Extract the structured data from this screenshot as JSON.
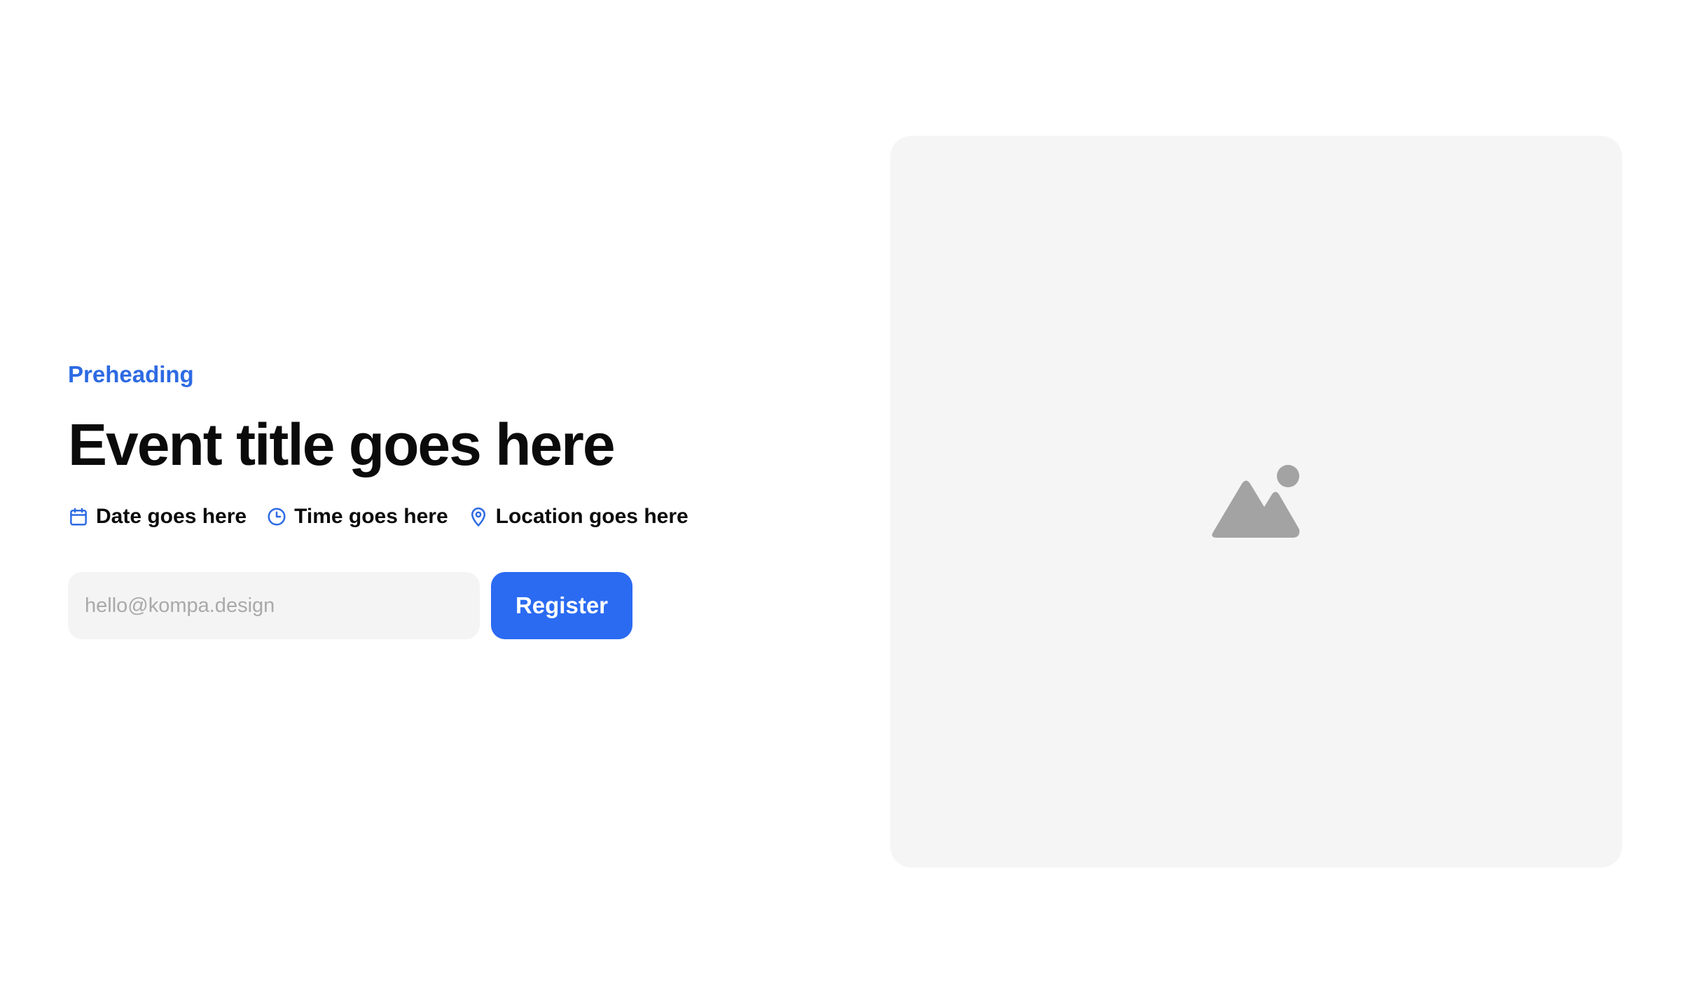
{
  "hero": {
    "preheading": "Preheading",
    "title": "Event title goes here",
    "meta": [
      {
        "icon": "calendar-icon",
        "label": "Date goes here"
      },
      {
        "icon": "clock-icon",
        "label": "Time goes here"
      },
      {
        "icon": "location-pin-icon",
        "label": "Location goes here"
      }
    ],
    "form": {
      "email_placeholder": "hello@kompa.design",
      "email_value": "",
      "register_label": "Register"
    }
  },
  "media": {
    "icon": "image-placeholder-icon"
  },
  "colors": {
    "accent": "#2b6bf2",
    "preheading": "#2d6ae3",
    "text": "#0b0b0b",
    "placeholder_bg": "#f5f5f5",
    "placeholder_icon": "#a3a3a3",
    "input_bg": "#f4f4f4"
  }
}
